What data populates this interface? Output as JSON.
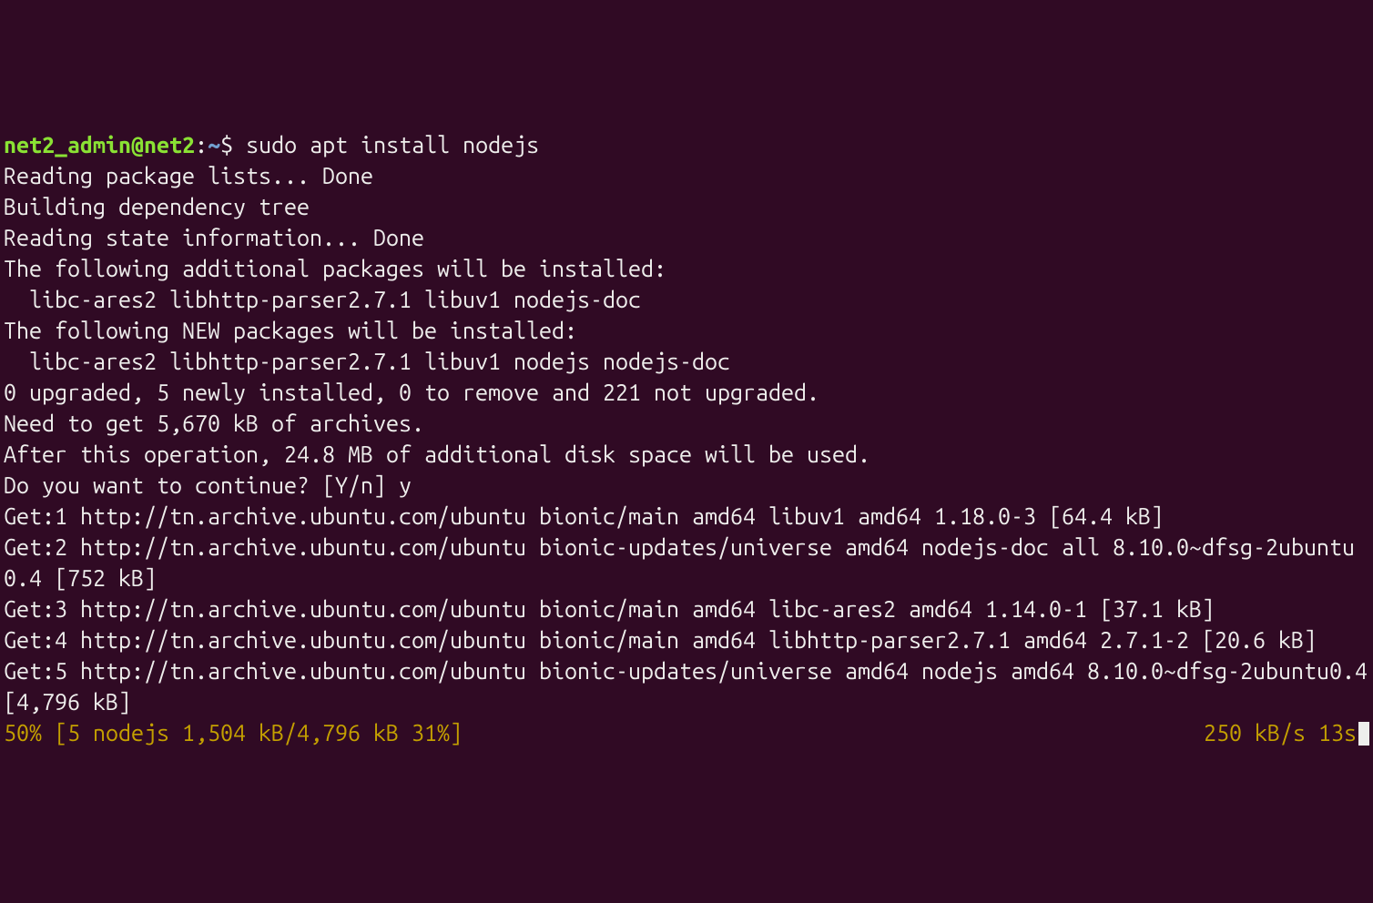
{
  "prompt": {
    "user": "net2_admin",
    "at": "@",
    "host": "net2",
    "colon": ":",
    "path": "~",
    "dollar": "$"
  },
  "command": "sudo apt install nodejs",
  "output": {
    "l1": "Reading package lists... Done",
    "l2": "Building dependency tree",
    "l3": "Reading state information... Done",
    "l4": "The following additional packages will be installed:",
    "l5": "  libc-ares2 libhttp-parser2.7.1 libuv1 nodejs-doc",
    "l6": "The following NEW packages will be installed:",
    "l7": "  libc-ares2 libhttp-parser2.7.1 libuv1 nodejs nodejs-doc",
    "l8": "0 upgraded, 5 newly installed, 0 to remove and 221 not upgraded.",
    "l9": "Need to get 5,670 kB of archives.",
    "l10": "After this operation, 24.8 MB of additional disk space will be used.",
    "l11": "Do you want to continue? [Y/n] y",
    "l12": "Get:1 http://tn.archive.ubuntu.com/ubuntu bionic/main amd64 libuv1 amd64 1.18.0-3 [64.4 kB]",
    "l13": "Get:2 http://tn.archive.ubuntu.com/ubuntu bionic-updates/universe amd64 nodejs-doc all 8.10.0~dfsg-2ubuntu0.4 [752 kB]",
    "l14": "Get:3 http://tn.archive.ubuntu.com/ubuntu bionic/main amd64 libc-ares2 amd64 1.14.0-1 [37.1 kB]",
    "l15": "Get:4 http://tn.archive.ubuntu.com/ubuntu bionic/main amd64 libhttp-parser2.7.1 amd64 2.7.1-2 [20.6 kB]",
    "l16": "Get:5 http://tn.archive.ubuntu.com/ubuntu bionic-updates/universe amd64 nodejs amd64 8.10.0~dfsg-2ubuntu0.4 [4,796 kB]"
  },
  "progress": {
    "left": "50% [5 nodejs 1,504 kB/4,796 kB 31%]",
    "right": "250 kB/s 13s"
  }
}
